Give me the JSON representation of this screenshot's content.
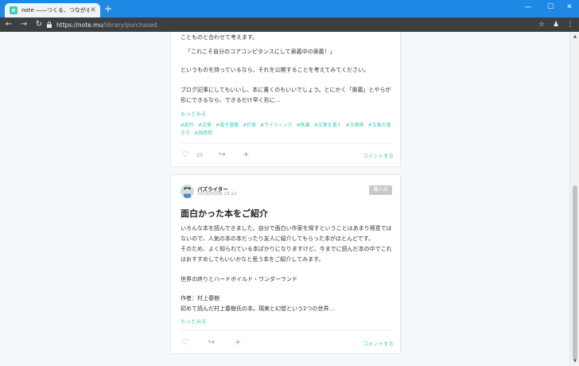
{
  "browser": {
    "tab_title": "note ――つくる、つながる、とどける。",
    "tab_favicon": "n",
    "url_host": "https://note.mu",
    "url_path": "/library/purchased",
    "icons": {
      "back": "back-arrow-icon",
      "forward": "forward-arrow-icon",
      "reload": "reload-icon",
      "lock": "lock-icon",
      "star": "bookmark-star-icon",
      "ext": "extension-icon",
      "menu": "kebab-menu-icon"
    }
  },
  "card1": {
    "top_line": "ことものと合わせて考えます。",
    "quote": "「これこそ自分のコアコンピタンスにして奥義中の奥義！」",
    "para1": "というものを持っているなら、それを公開することを考えてみてください。",
    "para2a": "ブログ記事にしてもいいし、本に書くのもいいでしょう。とにかく「奥義」とやらが",
    "para2b": "形にできるなら、できるだけ早く形に…",
    "more": "もっとみる",
    "tags": [
      "#創作",
      "#文章",
      "#電子書籍",
      "#作家",
      "#ライティング",
      "#執筆",
      "#文章を書く",
      "#文章術",
      "#文章の書き方",
      "#読感想"
    ],
    "likes": "25",
    "comment": "コメントする"
  },
  "card2": {
    "author": "パズライター",
    "date": "2019/03/06 23:12",
    "badge": "購入済",
    "title": "面白かった本をご紹介",
    "lines": [
      "いろんな本を読んできました。自分で面白い作家を探すということはあまり得意では",
      "ないので、人気の本の本だったり友人に紹介してもらった本がほとんどです。",
      "そのため、よく知られている本ばかりになりますけど、今までに読んだ本の中でこれ",
      "はおすすめしてもいいかなと思う本をご紹介してみます。"
    ],
    "book": "世界の終りとハードボイルド・ワンダーランド",
    "author_line": "作者：村上春樹",
    "desc": "初めて読んだ村上春樹氏の本。現実と幻想という2つの世界…",
    "more": "もっとみる",
    "comment": "コメントする"
  }
}
